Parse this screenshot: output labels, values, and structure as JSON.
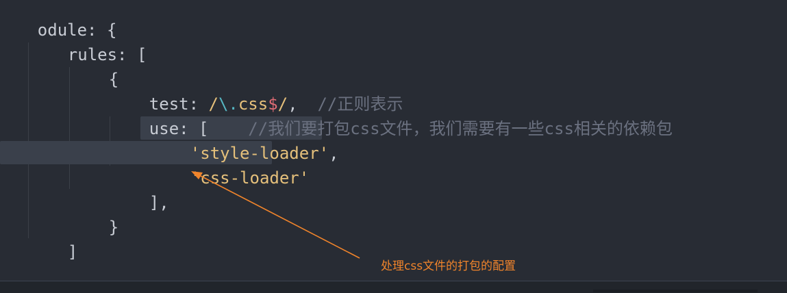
{
  "code": {
    "line1": {
      "text": "odule: {"
    },
    "line2": {
      "text": "rules: ["
    },
    "line3": {
      "text": "{"
    },
    "line4": {
      "key": "test: ",
      "re_open": "/",
      "re_escape": "\\.",
      "re_body": "css",
      "re_anchor": "$",
      "re_close": "/",
      "comma": ",",
      "comment": "//正则表示"
    },
    "line5": {
      "key": "use: [",
      "comment": "//我们要打包css文件，我们需要有一些css相关的依赖包"
    },
    "line6": {
      "str": "'style-loader'",
      "comma": ","
    },
    "line7": {
      "str": "'css-loader'"
    },
    "line8": {
      "text": "],"
    },
    "line9": {
      "text": "}"
    },
    "line10": {
      "text": "]"
    }
  },
  "annotation": {
    "text": "处理css文件的打包的配置",
    "color": "#f0842b"
  },
  "colors": {
    "background": "#282c34",
    "string": "#e5c07b",
    "comment": "#6b7180",
    "regex_anchor": "#e06c75",
    "regex_escape": "#56b6c2"
  }
}
